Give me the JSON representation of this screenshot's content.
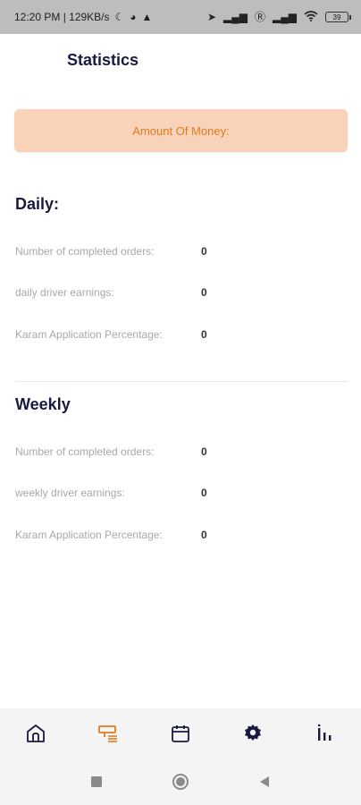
{
  "status_bar": {
    "time_and_speed": "12:20 PM | 129KB/s",
    "battery": "39"
  },
  "header": {
    "title": "Statistics"
  },
  "amount_card": {
    "label": "Amount Of Money:"
  },
  "daily": {
    "title": "Daily:",
    "rows": [
      {
        "label": "Number of completed orders:",
        "value": "0"
      },
      {
        "label": "daily driver earnings:",
        "value": "0"
      },
      {
        "label": "Karam Application Percentage:",
        "value": "0"
      }
    ]
  },
  "weekly": {
    "title": "Weekly",
    "rows": [
      {
        "label": "Number of completed orders:",
        "value": "0"
      },
      {
        "label": "weekly driver earnings:",
        "value": "0"
      },
      {
        "label": "Karam Application Percentage:",
        "value": "0"
      }
    ]
  },
  "bottom_nav": {
    "items": [
      {
        "icon": "home-icon"
      },
      {
        "icon": "orders-icon",
        "active": true
      },
      {
        "icon": "calendar-icon"
      },
      {
        "icon": "settings-icon"
      },
      {
        "icon": "statistics-icon"
      }
    ]
  },
  "colors": {
    "accent": "#e07b1f",
    "card_bg": "#f9d3b9",
    "navy": "#1a1a40"
  }
}
